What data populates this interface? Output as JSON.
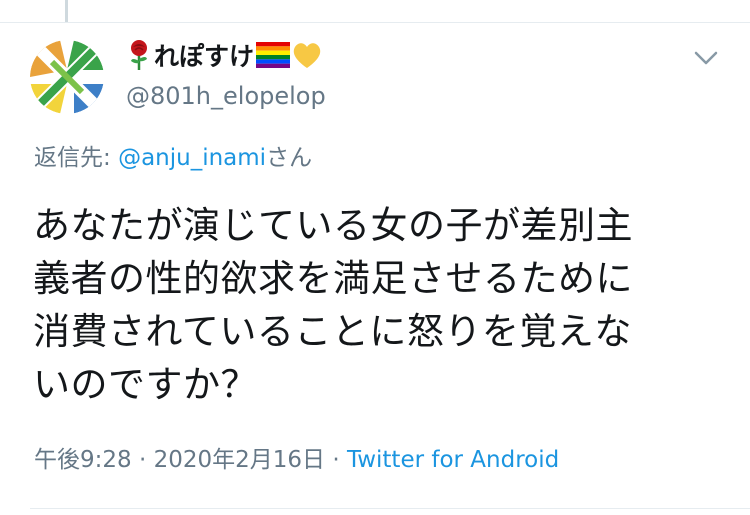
{
  "tweet": {
    "author": {
      "display_name": "れぽすけ",
      "handle": "@801h_elopelop",
      "name_icons": [
        "rose-icon",
        "rainbow-flag-icon",
        "yellow-heart-icon"
      ],
      "avatar_colors": [
        "#e9a23b",
        "#3aa34a",
        "#f2d43b",
        "#3d7fc7",
        "#ffffff"
      ]
    },
    "reply_prefix": "返信先: ",
    "reply_to": "@anju_inami",
    "reply_suffix": "さん",
    "text_lines": [
      "あなたが演じている女の子が差別主",
      "義者の性的欲求を満足させるために",
      "消費されていることに怒りを覚えな",
      "いのですか？"
    ],
    "time": "午後9:28",
    "separator": " · ",
    "date": "2020年2月16日",
    "source": "Twitter for Android",
    "menu_icon": "chevron-down-icon",
    "colors": {
      "link": "#1b95e0",
      "secondary_text": "#657786",
      "primary_text": "#14171a"
    }
  }
}
